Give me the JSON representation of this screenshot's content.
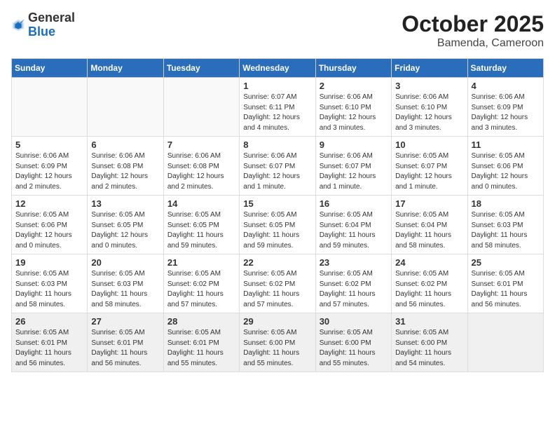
{
  "header": {
    "logo_general": "General",
    "logo_blue": "Blue",
    "month": "October 2025",
    "location": "Bamenda, Cameroon"
  },
  "weekdays": [
    "Sunday",
    "Monday",
    "Tuesday",
    "Wednesday",
    "Thursday",
    "Friday",
    "Saturday"
  ],
  "weeks": [
    [
      {
        "day": "",
        "info": ""
      },
      {
        "day": "",
        "info": ""
      },
      {
        "day": "",
        "info": ""
      },
      {
        "day": "1",
        "info": "Sunrise: 6:07 AM\nSunset: 6:11 PM\nDaylight: 12 hours\nand 4 minutes."
      },
      {
        "day": "2",
        "info": "Sunrise: 6:06 AM\nSunset: 6:10 PM\nDaylight: 12 hours\nand 3 minutes."
      },
      {
        "day": "3",
        "info": "Sunrise: 6:06 AM\nSunset: 6:10 PM\nDaylight: 12 hours\nand 3 minutes."
      },
      {
        "day": "4",
        "info": "Sunrise: 6:06 AM\nSunset: 6:09 PM\nDaylight: 12 hours\nand 3 minutes."
      }
    ],
    [
      {
        "day": "5",
        "info": "Sunrise: 6:06 AM\nSunset: 6:09 PM\nDaylight: 12 hours\nand 2 minutes."
      },
      {
        "day": "6",
        "info": "Sunrise: 6:06 AM\nSunset: 6:08 PM\nDaylight: 12 hours\nand 2 minutes."
      },
      {
        "day": "7",
        "info": "Sunrise: 6:06 AM\nSunset: 6:08 PM\nDaylight: 12 hours\nand 2 minutes."
      },
      {
        "day": "8",
        "info": "Sunrise: 6:06 AM\nSunset: 6:07 PM\nDaylight: 12 hours\nand 1 minute."
      },
      {
        "day": "9",
        "info": "Sunrise: 6:06 AM\nSunset: 6:07 PM\nDaylight: 12 hours\nand 1 minute."
      },
      {
        "day": "10",
        "info": "Sunrise: 6:05 AM\nSunset: 6:07 PM\nDaylight: 12 hours\nand 1 minute."
      },
      {
        "day": "11",
        "info": "Sunrise: 6:05 AM\nSunset: 6:06 PM\nDaylight: 12 hours\nand 0 minutes."
      }
    ],
    [
      {
        "day": "12",
        "info": "Sunrise: 6:05 AM\nSunset: 6:06 PM\nDaylight: 12 hours\nand 0 minutes."
      },
      {
        "day": "13",
        "info": "Sunrise: 6:05 AM\nSunset: 6:05 PM\nDaylight: 12 hours\nand 0 minutes."
      },
      {
        "day": "14",
        "info": "Sunrise: 6:05 AM\nSunset: 6:05 PM\nDaylight: 11 hours\nand 59 minutes."
      },
      {
        "day": "15",
        "info": "Sunrise: 6:05 AM\nSunset: 6:05 PM\nDaylight: 11 hours\nand 59 minutes."
      },
      {
        "day": "16",
        "info": "Sunrise: 6:05 AM\nSunset: 6:04 PM\nDaylight: 11 hours\nand 59 minutes."
      },
      {
        "day": "17",
        "info": "Sunrise: 6:05 AM\nSunset: 6:04 PM\nDaylight: 11 hours\nand 58 minutes."
      },
      {
        "day": "18",
        "info": "Sunrise: 6:05 AM\nSunset: 6:03 PM\nDaylight: 11 hours\nand 58 minutes."
      }
    ],
    [
      {
        "day": "19",
        "info": "Sunrise: 6:05 AM\nSunset: 6:03 PM\nDaylight: 11 hours\nand 58 minutes."
      },
      {
        "day": "20",
        "info": "Sunrise: 6:05 AM\nSunset: 6:03 PM\nDaylight: 11 hours\nand 58 minutes."
      },
      {
        "day": "21",
        "info": "Sunrise: 6:05 AM\nSunset: 6:02 PM\nDaylight: 11 hours\nand 57 minutes."
      },
      {
        "day": "22",
        "info": "Sunrise: 6:05 AM\nSunset: 6:02 PM\nDaylight: 11 hours\nand 57 minutes."
      },
      {
        "day": "23",
        "info": "Sunrise: 6:05 AM\nSunset: 6:02 PM\nDaylight: 11 hours\nand 57 minutes."
      },
      {
        "day": "24",
        "info": "Sunrise: 6:05 AM\nSunset: 6:02 PM\nDaylight: 11 hours\nand 56 minutes."
      },
      {
        "day": "25",
        "info": "Sunrise: 6:05 AM\nSunset: 6:01 PM\nDaylight: 11 hours\nand 56 minutes."
      }
    ],
    [
      {
        "day": "26",
        "info": "Sunrise: 6:05 AM\nSunset: 6:01 PM\nDaylight: 11 hours\nand 56 minutes."
      },
      {
        "day": "27",
        "info": "Sunrise: 6:05 AM\nSunset: 6:01 PM\nDaylight: 11 hours\nand 56 minutes."
      },
      {
        "day": "28",
        "info": "Sunrise: 6:05 AM\nSunset: 6:01 PM\nDaylight: 11 hours\nand 55 minutes."
      },
      {
        "day": "29",
        "info": "Sunrise: 6:05 AM\nSunset: 6:00 PM\nDaylight: 11 hours\nand 55 minutes."
      },
      {
        "day": "30",
        "info": "Sunrise: 6:05 AM\nSunset: 6:00 PM\nDaylight: 11 hours\nand 55 minutes."
      },
      {
        "day": "31",
        "info": "Sunrise: 6:05 AM\nSunset: 6:00 PM\nDaylight: 11 hours\nand 54 minutes."
      },
      {
        "day": "",
        "info": ""
      }
    ]
  ]
}
